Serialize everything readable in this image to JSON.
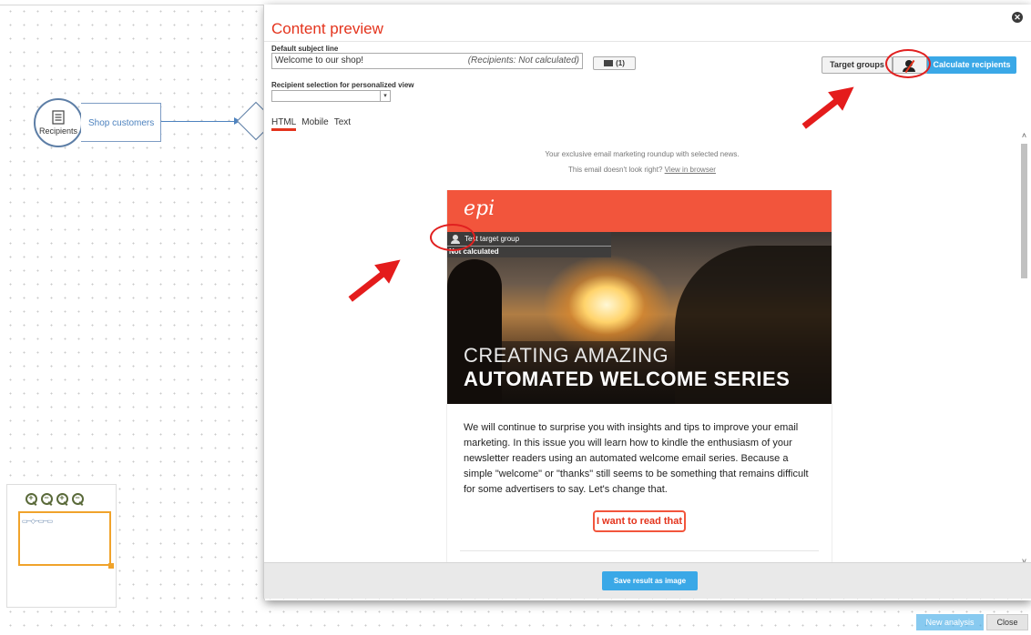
{
  "canvas": {
    "node_label": "Recipients",
    "shop_label": "Shop customers"
  },
  "minimap": {
    "zoom_symbols": [
      "+",
      "−",
      "+",
      "−"
    ],
    "mini_diagram": "▭─◇─▭─▭"
  },
  "modal": {
    "title": "Content preview",
    "close_symbol": "✕",
    "subject_label": "Default subject line",
    "subject_value": "Welcome to our shop!",
    "subject_recipients": "(Recipients: Not calculated)",
    "folder_count": "(1)",
    "recipient_selection_label": "Recipient selection for personalized view",
    "select_arrow": "▾",
    "target_groups_label": "Target groups",
    "calculate_label": "Calculate recipients",
    "tabs": [
      "HTML",
      "Mobile",
      "Text"
    ],
    "scroll_up": "˄",
    "scroll_down": "˅",
    "save_label": "Save result as image"
  },
  "email": {
    "preheader": "Your exclusive email marketing roundup with selected news.",
    "view_prefix": "This email doesn't look right?",
    "view_link": "View in browser",
    "logo": "epi",
    "overlay_group": "Test target group",
    "overlay_status": "Not calculated",
    "hero_line1": "CREATING AMAZING",
    "hero_line2": "AUTOMATED WELCOME SERIES",
    "body": "We will continue to surprise you with insights and tips to improve your email marketing. In this issue you will learn how to kindle the enthusiasm of your newsletter readers using an automated welcome email series. Because a simple \"welcome\" or \"thanks\" still seems to be something that remains difficult for some advertisers to say. Let's change that.",
    "cta": "I want to read that"
  },
  "bottom": {
    "new_analysis": "New analysis",
    "close": "Close"
  },
  "colors": {
    "accent_red": "#e4341d",
    "button_blue": "#3aa8e7",
    "email_orange": "#f2553c",
    "marker_red": "#e41c1c"
  }
}
